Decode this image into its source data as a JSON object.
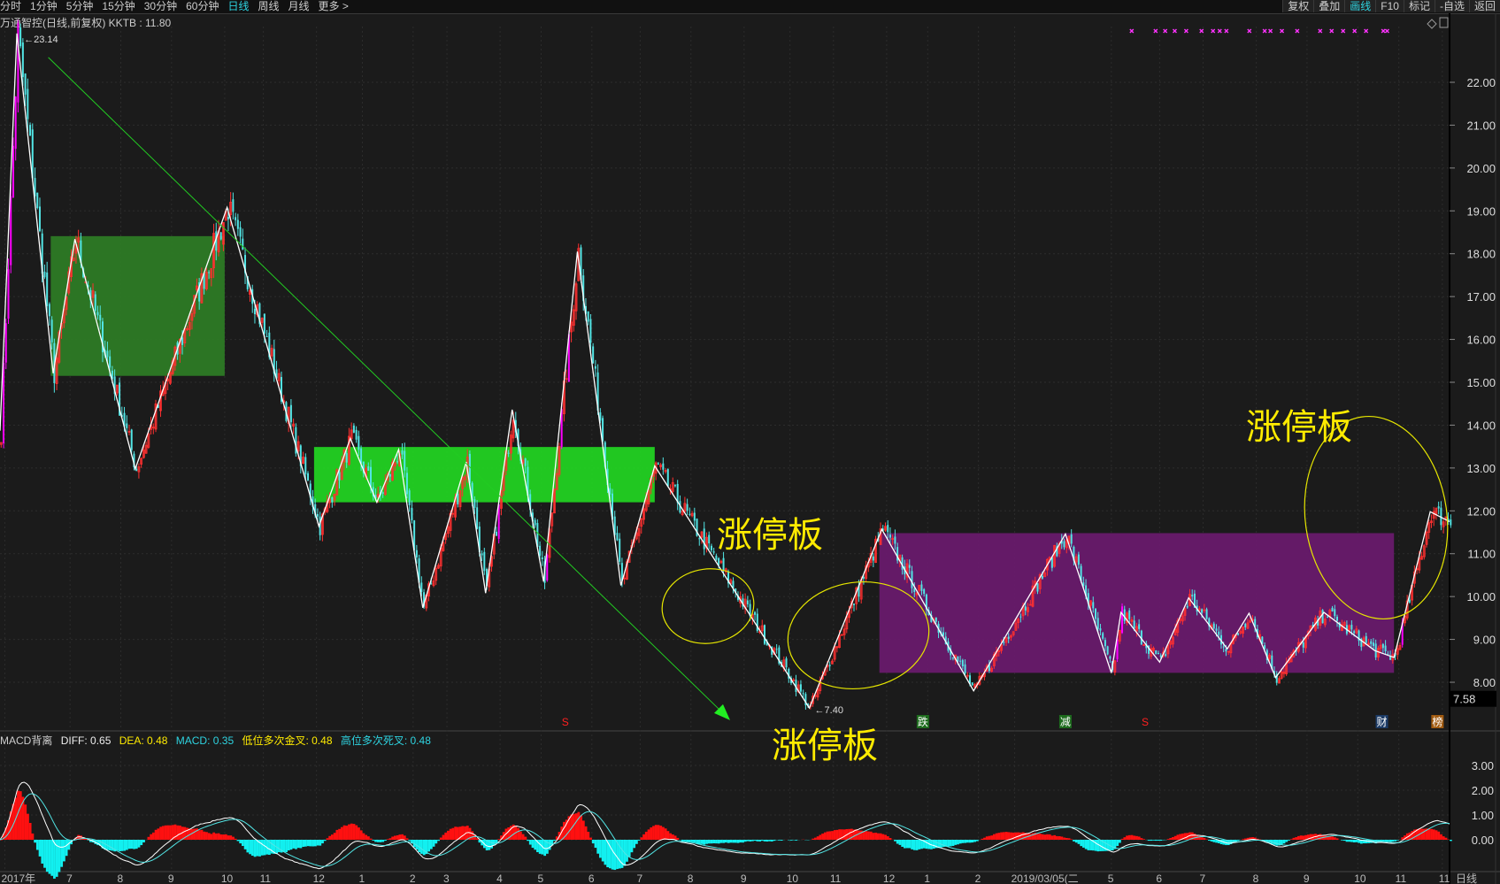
{
  "toolbar": {
    "periods": [
      "分时",
      "1分钟",
      "5分钟",
      "15分钟",
      "30分钟",
      "60分钟",
      "日线",
      "周线",
      "月线",
      "更多 >"
    ],
    "active_period": "日线",
    "tools": [
      "复权",
      "叠加",
      "画线",
      "F10",
      "标记",
      "-自选",
      "返回"
    ],
    "active_tool": "画线"
  },
  "title": {
    "stock": "万通智控(日线,前复权)",
    "indicator": "KKTB",
    "value": ": 11.80"
  },
  "macd_header": {
    "name": "MACD背离",
    "diff": "DIFF: 0.65",
    "dea": "DEA: 0.48",
    "macd": "MACD: 0.35",
    "low_cross": "低位多次金叉: 0.48",
    "high_cross": "高位多次死叉: 0.48"
  },
  "annotations": [
    "涨停板",
    "涨停板",
    "涨停板"
  ],
  "colors": {
    "up": "#ff3030",
    "down": "#52e5e5",
    "limit": "#ff00ff",
    "zigzag": "#ffffff",
    "accent": "#2ed3e0",
    "annotation": "#ffeb00"
  },
  "chart_data": {
    "type": "candlestick",
    "bars": 600,
    "ylim": [
      7.0,
      23.3
    ],
    "price_ticks": [
      "8.00",
      "9.00",
      "10.00",
      "11.00",
      "12.00",
      "13.00",
      "14.00",
      "15.00",
      "16.00",
      "17.00",
      "18.00",
      "19.00",
      "20.00",
      "21.00",
      "22.00"
    ],
    "current_price_label": "7.58",
    "high_label": "23.14",
    "low_label": "7.40",
    "zigzag": [
      [
        0,
        13.87
      ],
      [
        7,
        23.14
      ],
      [
        22,
        15.21
      ],
      [
        31,
        18.34
      ],
      [
        56,
        12.98
      ],
      [
        94,
        19.08
      ],
      [
        132,
        11.64
      ],
      [
        145,
        13.69
      ],
      [
        156,
        12.2
      ],
      [
        165,
        13.43
      ],
      [
        175,
        9.74
      ],
      [
        193,
        13.14
      ],
      [
        201,
        10.08
      ],
      [
        212,
        14.36
      ],
      [
        225,
        10.35
      ],
      [
        239,
        18.05
      ],
      [
        257,
        10.26
      ],
      [
        271,
        13.05
      ],
      [
        335,
        7.4
      ],
      [
        365,
        11.57
      ],
      [
        403,
        7.8
      ],
      [
        441,
        11.46
      ],
      [
        460,
        8.22
      ],
      [
        464,
        9.63
      ],
      [
        480,
        8.47
      ],
      [
        492,
        9.97
      ],
      [
        508,
        8.78
      ],
      [
        517,
        9.61
      ],
      [
        528,
        8.11
      ],
      [
        548,
        9.63
      ],
      [
        569,
        8.74
      ],
      [
        577,
        8.58
      ],
      [
        592,
        11.98
      ],
      [
        600,
        11.75
      ]
    ],
    "boxes": [
      {
        "from": 21,
        "to": 93,
        "low": 15.15,
        "high": 18.41,
        "color": "#2e7d25"
      },
      {
        "from": 130,
        "to": 271,
        "low": 12.2,
        "high": 13.49,
        "color": "#22d622"
      },
      {
        "from": 364,
        "to": 577,
        "low": 8.22,
        "high": 11.48,
        "color": "#6a1a6e"
      }
    ],
    "trend_arrow": {
      "from": [
        20,
        22.58
      ],
      "to": [
        300,
        7.24
      ]
    },
    "markers": [
      {
        "bar": 234,
        "text": "S",
        "color": "#ff2020",
        "bg": ""
      },
      {
        "bar": 382,
        "text": "跌",
        "color": "#ffffff",
        "bg": "#1d6b1d"
      },
      {
        "bar": 441,
        "text": "减",
        "color": "#ffffff",
        "bg": "#1d6b1d"
      },
      {
        "bar": 474,
        "text": "S",
        "color": "#ff2020",
        "bg": ""
      },
      {
        "bar": 572,
        "text": "财",
        "color": "#ffffff",
        "bg": "#1c3b66"
      },
      {
        "bar": 595,
        "text": "榜",
        "color": "#ffffff",
        "bg": "#a05a10"
      }
    ],
    "macd_ticks": [
      "0.00",
      "1.00",
      "2.00",
      "3.00"
    ],
    "macd_ylim": [
      -1.2,
      4.0
    ],
    "time_axis": [
      {
        "bar": 2,
        "label": "2017年"
      },
      {
        "bar": 29,
        "label": "7"
      },
      {
        "bar": 50,
        "label": "8"
      },
      {
        "bar": 71,
        "label": "9"
      },
      {
        "bar": 93,
        "label": "10"
      },
      {
        "bar": 109,
        "label": "11"
      },
      {
        "bar": 131,
        "label": "12"
      },
      {
        "bar": 150,
        "label": "1"
      },
      {
        "bar": 171,
        "label": "2"
      },
      {
        "bar": 185,
        "label": "3"
      },
      {
        "bar": 207,
        "label": "4"
      },
      {
        "bar": 224,
        "label": "5"
      },
      {
        "bar": 245,
        "label": "6"
      },
      {
        "bar": 265,
        "label": "7"
      },
      {
        "bar": 286,
        "label": "8"
      },
      {
        "bar": 308,
        "label": "9"
      },
      {
        "bar": 327,
        "label": "10"
      },
      {
        "bar": 345,
        "label": "11"
      },
      {
        "bar": 367,
        "label": "12"
      },
      {
        "bar": 384,
        "label": "1"
      },
      {
        "bar": 405,
        "label": "2"
      },
      {
        "bar": 420,
        "label": "2019/03/05(二"
      },
      {
        "bar": 460,
        "label": "5"
      },
      {
        "bar": 480,
        "label": "6"
      },
      {
        "bar": 498,
        "label": "7"
      },
      {
        "bar": 520,
        "label": "8"
      },
      {
        "bar": 541,
        "label": "9"
      },
      {
        "bar": 562,
        "label": "10"
      },
      {
        "bar": 579,
        "label": "11"
      },
      {
        "bar": 597,
        "label": "11"
      }
    ],
    "period_label": "日线"
  }
}
